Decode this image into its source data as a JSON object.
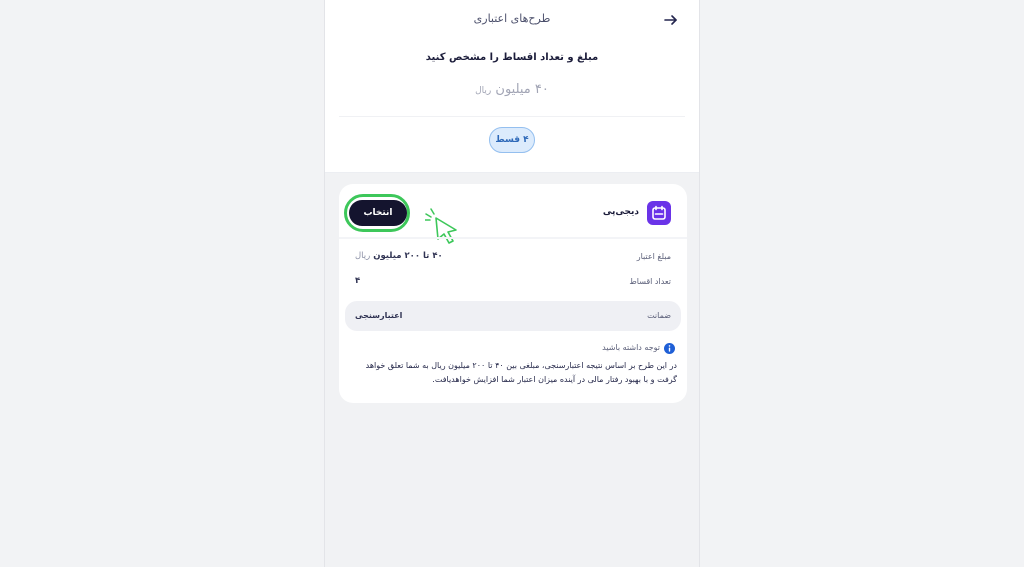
{
  "header": {
    "title": "طرح‌های اعتباری",
    "back_icon": "arrow-right-icon"
  },
  "selection": {
    "subtitle": "مبلغ و تعداد اقساط را مشخص کنید",
    "amount_value": "۴۰ میلیون",
    "amount_unit": "ریال",
    "installment_chip": "۴ قسط"
  },
  "plan": {
    "brand": "دیجی‌پی",
    "brand_icon": "digipay-logo-icon",
    "select_label": "انتخاب",
    "credit_amount_label": "مبلغ اعتبار",
    "credit_amount_value": "۴۰ تا ۲۰۰ میلیون",
    "credit_amount_unit": "ریال",
    "installments_label": "تعداد اقساط",
    "installments_value": "۴",
    "guarantee_label": "ضمانت",
    "guarantee_value": "اعتبارسنجی",
    "note_title": "توجه داشته باشید",
    "note_body": "در این طرح بر اساس نتیجه اعتبارسنجی، مبلغی بین ۴۰ تا ۲۰۰ میلیون ریال به شما تعلق خواهد گرفت و با بهبود رفتار مالی در آینده میزان اعتبار شما افزایش خواهدیافت."
  },
  "colors": {
    "brand": "#6a33e8",
    "primary_button": "#14142e",
    "highlight": "#3dc75a",
    "chip_bg": "#dcebfc",
    "info": "#1f5fd6"
  }
}
